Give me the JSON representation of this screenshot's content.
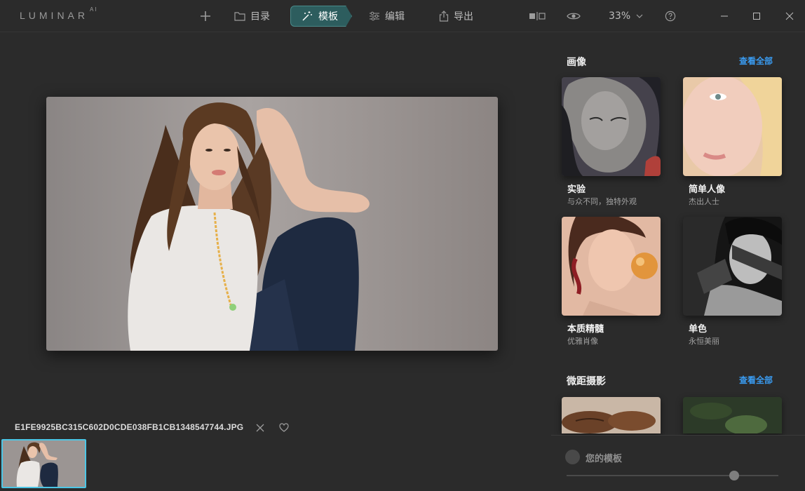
{
  "app": {
    "logo": "LUMINAR",
    "logo_suffix": "AI"
  },
  "toolbar": {
    "catalog_label": "目录",
    "templates_label": "模板",
    "edit_label": "编辑",
    "export_label": "导出",
    "zoom_value": "33%"
  },
  "image": {
    "filename": "E1FE9925BC315C602D0CDE038FB1CB1348547744.JPG"
  },
  "panel": {
    "sections": [
      {
        "title": "画像",
        "see_all": "查看全部",
        "cards": [
          {
            "name": "实验",
            "desc": "与众不同，独特外观"
          },
          {
            "name": "简单人像",
            "desc": "杰出人士"
          },
          {
            "name": "本质精髓",
            "desc": "优雅肖像"
          },
          {
            "name": "单色",
            "desc": "永恒美丽"
          }
        ]
      },
      {
        "title": "微距摄影",
        "see_all": "查看全部"
      }
    ],
    "your_templates": "您的模板"
  },
  "colors": {
    "accent": "#2d5d5e",
    "link": "#3a9cf2",
    "thumb_border": "#4cc6e6"
  }
}
